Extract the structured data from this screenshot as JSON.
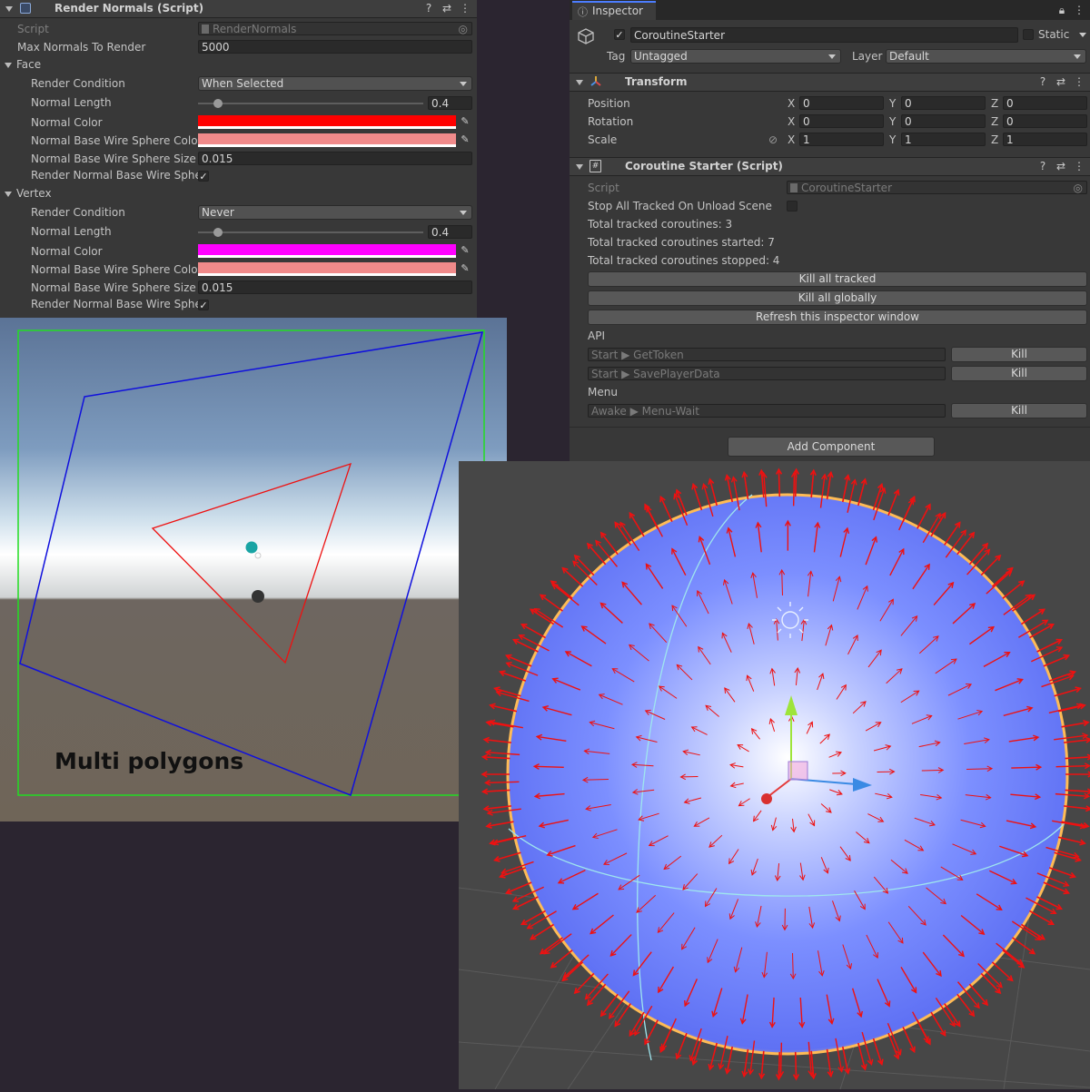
{
  "render_normals": {
    "header_title": "Render Normals (Script)",
    "script_label": "Script",
    "script_value": "RenderNormals",
    "max_normals_label": "Max Normals To Render",
    "max_normals_value": "5000",
    "face": {
      "section_label": "Face",
      "render_condition_label": "Render Condition",
      "render_condition_value": "When Selected",
      "normal_length_label": "Normal Length",
      "normal_length_value": "0.4",
      "normal_color_label": "Normal Color",
      "normal_color": "#ff0000",
      "wire_color_label": "Normal Base Wire Sphere Color",
      "wire_color": "#f08a8a",
      "wire_size_label": "Normal Base Wire Sphere Size",
      "wire_size_value": "0.015",
      "render_wire_label": "Render Normal Base Wire Spher",
      "render_wire_checked": "✓"
    },
    "vertex": {
      "section_label": "Vertex",
      "render_condition_label": "Render Condition",
      "render_condition_value": "Never",
      "normal_length_label": "Normal Length",
      "normal_length_value": "0.4",
      "normal_color_label": "Normal Color",
      "normal_color": "#ff00ff",
      "wire_color_label": "Normal Base Wire Sphere Color",
      "wire_color": "#f08a8a",
      "wire_size_label": "Normal Base Wire Sphere Size",
      "wire_size_value": "0.015",
      "render_wire_label": "Render Normal Base Wire Spher",
      "render_wire_checked": "✓"
    }
  },
  "inspector": {
    "tab_label": "Inspector",
    "object_name": "CoroutineStarter",
    "static_label": "Static",
    "tag_label": "Tag",
    "tag_value": "Untagged",
    "layer_label": "Layer",
    "layer_value": "Default",
    "transform": {
      "title": "Transform",
      "position_label": "Position",
      "rotation_label": "Rotation",
      "scale_label": "Scale",
      "x_label": "X",
      "y_label": "Y",
      "z_label": "Z",
      "position": [
        "0",
        "0",
        "0"
      ],
      "rotation": [
        "0",
        "0",
        "0"
      ],
      "scale": [
        "1",
        "1",
        "1"
      ]
    },
    "coroutine": {
      "title": "Coroutine Starter (Script)",
      "script_label": "Script",
      "script_value": "CoroutineStarter",
      "stop_all_label": "Stop All Tracked On Unload Scene",
      "total_tracked": "Total tracked coroutines: 3",
      "total_started": "Total tracked coroutines started: 7",
      "total_stopped": "Total tracked coroutines stopped: 4",
      "kill_all_tracked": "Kill all tracked",
      "kill_all_globally": "Kill all globally",
      "refresh": "Refresh this inspector window",
      "groups": [
        {
          "name": "API",
          "rows": [
            {
              "label": "Start ▶ GetToken",
              "button": "Kill"
            },
            {
              "label": "Start ▶ SavePlayerData",
              "button": "Kill"
            }
          ]
        },
        {
          "name": "Menu",
          "rows": [
            {
              "label": "Awake ▶ Menu-Wait",
              "button": "Kill"
            }
          ]
        }
      ]
    },
    "add_component": "Add Component"
  },
  "scene_polygons": {
    "caption": "Multi polygons",
    "colors": {
      "frame": "#22dd22",
      "square": "#1010dd",
      "triangle": "#ee1111"
    }
  },
  "scene_sphere": {
    "colors": {
      "sphere": "#6f83ff",
      "arrows": "#ee1111",
      "grid": "#555555"
    }
  }
}
